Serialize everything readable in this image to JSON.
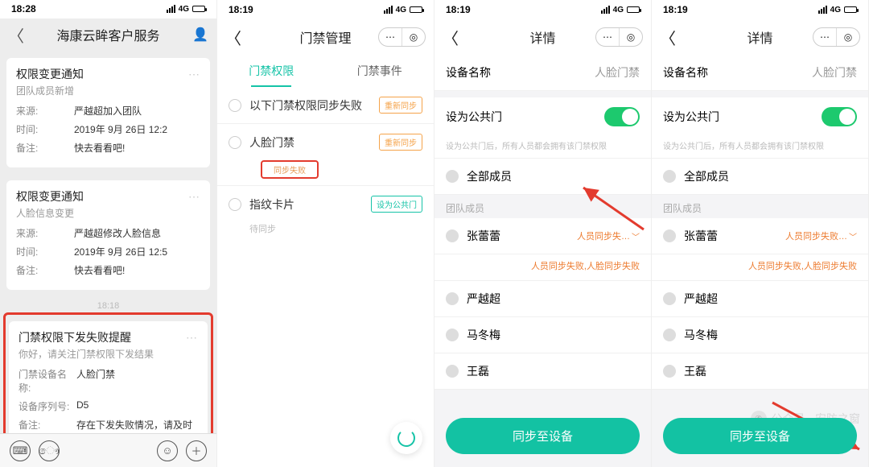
{
  "screen1": {
    "status_time": "18:28",
    "net_label": "4G",
    "title": "海康云眸客户服务",
    "cards": [
      {
        "title": "权限变更通知",
        "sub": "团队成员新增",
        "k_source": "来源:",
        "v_source": "严越超加入团队",
        "k_time": "时间:",
        "v_time": "2019年 9月 26日 12:2",
        "k_note": "备注:",
        "v_note": "快去看看吧!"
      },
      {
        "title": "权限变更通知",
        "sub": "人脸信息变更",
        "k_source": "来源:",
        "v_source": "严越超修改人脸信息",
        "k_time": "时间:",
        "v_time": "2019年 9月 26日 12:5",
        "k_note": "备注:",
        "v_note": "快去看看吧!"
      }
    ],
    "time_sep": "18:18",
    "alert_card": {
      "title": "门禁权限下发失败提醒",
      "sub": "你好，请关注门禁权限下发结果",
      "k_dev": "门禁设备名称:",
      "v_dev": "人脸门禁",
      "k_sn": "设备序列号:",
      "v_sn": "D5",
      "k_note": "备注:",
      "v_note": "存在下发失败情况，请及时处理"
    }
  },
  "screen2": {
    "status_time": "18:19",
    "net_label": "4G",
    "title": "门禁管理",
    "tab_perm": "门禁权限",
    "tab_event": "门禁事件",
    "row_fail_label": "以下门禁权限同步失败",
    "btn_resync": "重新同步",
    "row_face": "人脸门禁",
    "badge_sync_fail": "同步失败",
    "row_fp": "指纹卡片",
    "sub_fp": "待同步",
    "btn_public": "设为公共门"
  },
  "screen3": {
    "status_time": "18:19",
    "net_label": "4G",
    "title": "详情",
    "k_dev": "设备名称",
    "v_dev": "人脸门禁",
    "k_public": "设为公共门",
    "hint": "设为公共门后，所有人员都会拥有该门禁权限",
    "lbl_all": "全部成员",
    "section_members": "团队成员",
    "members": [
      "张蕾蕾",
      "严越超",
      "马冬梅",
      "王磊"
    ],
    "member0_err": "人员同步失…",
    "err_line": "人员同步失败,人脸同步失败",
    "sync_btn": "同步至设备"
  },
  "screen4": {
    "status_time": "18:19",
    "net_label": "4G",
    "title": "详情",
    "k_dev": "设备名称",
    "v_dev": "人脸门禁",
    "k_public": "设为公共门",
    "hint": "设为公共门后，所有人员都会拥有该门禁权限",
    "lbl_all": "全部成员",
    "section_members": "团队成员",
    "members": [
      "张蕾蕾",
      "严越超",
      "马冬梅",
      "王磊"
    ],
    "member0_err": "人员同步失败…",
    "err_line": "人员同步失败,人脸同步失败",
    "sync_btn": "同步至设备"
  },
  "watermark": "公众号 · 安防之窗"
}
